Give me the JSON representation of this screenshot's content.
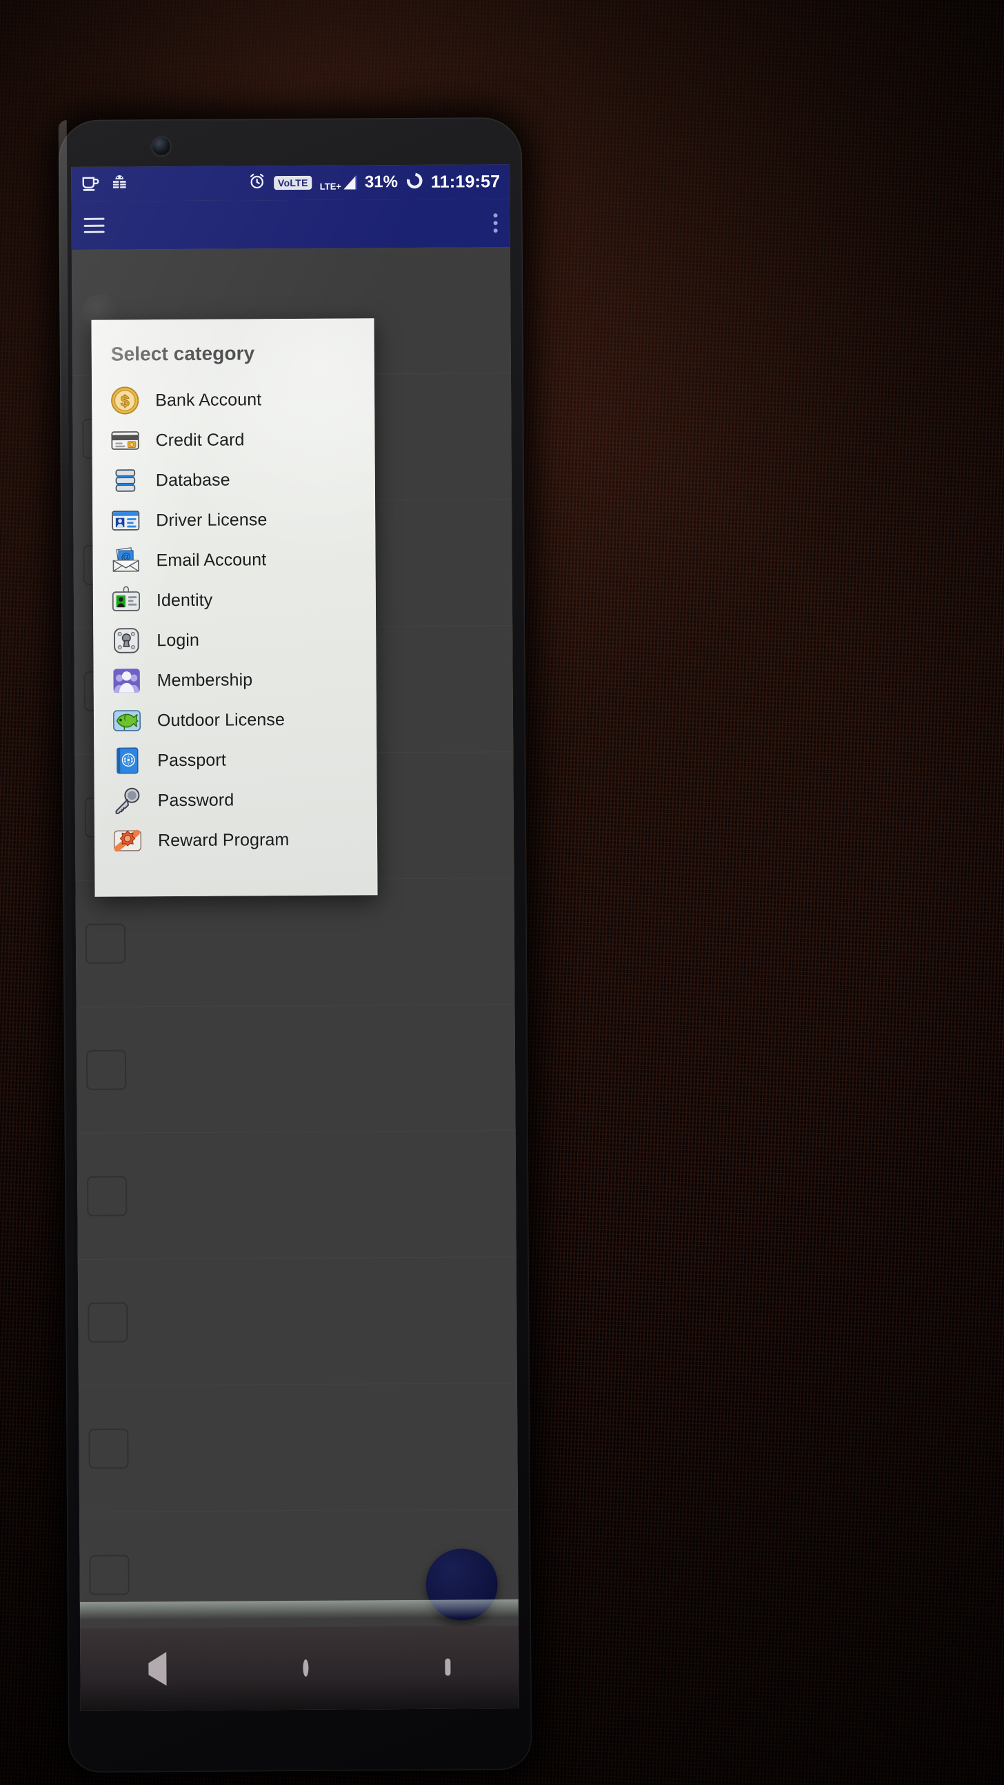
{
  "status_bar": {
    "left_icons": [
      {
        "name": "coffee-cup-icon",
        "glyph": "cup"
      },
      {
        "name": "android-debug-icon",
        "glyph": "android"
      }
    ],
    "alarm_icon": "alarm-clock-icon",
    "volte_badge": "VoLTE",
    "network_type": "LTE+",
    "battery_percent": "31%",
    "battery_icon": "battery-circle-icon",
    "time": "11:19:57"
  },
  "app_toolbar": {
    "menu_icon": "hamburger-menu-icon",
    "overflow_icon": "kebab-menu-icon"
  },
  "dialog": {
    "title": "Select category",
    "categories": [
      {
        "label": "Bank Account",
        "icon": "gold-coin-dollar-icon"
      },
      {
        "label": "Credit Card",
        "icon": "credit-card-icon"
      },
      {
        "label": "Database",
        "icon": "database-stack-icon"
      },
      {
        "label": "Driver License",
        "icon": "id-card-blue-icon"
      },
      {
        "label": "Email Account",
        "icon": "envelope-at-icon"
      },
      {
        "label": "Identity",
        "icon": "id-badge-green-icon"
      },
      {
        "label": "Login",
        "icon": "keyhole-plate-icon"
      },
      {
        "label": "Membership",
        "icon": "people-purple-icon"
      },
      {
        "label": "Outdoor License",
        "icon": "fish-green-icon"
      },
      {
        "label": "Passport",
        "icon": "passport-book-icon"
      },
      {
        "label": "Password",
        "icon": "key-gray-icon"
      },
      {
        "label": "Reward Program",
        "icon": "reward-gear-icon"
      }
    ]
  },
  "fab": {
    "name": "add-fab-button"
  },
  "nav_bar": {
    "back": "back-triangle-icon",
    "home": "home-circle-icon",
    "recents": "recents-square-icon"
  },
  "colors": {
    "toolbar_blue": "#1c2272",
    "dialog_bg": "#e9eae7",
    "text_primary": "#1b1b1d"
  }
}
